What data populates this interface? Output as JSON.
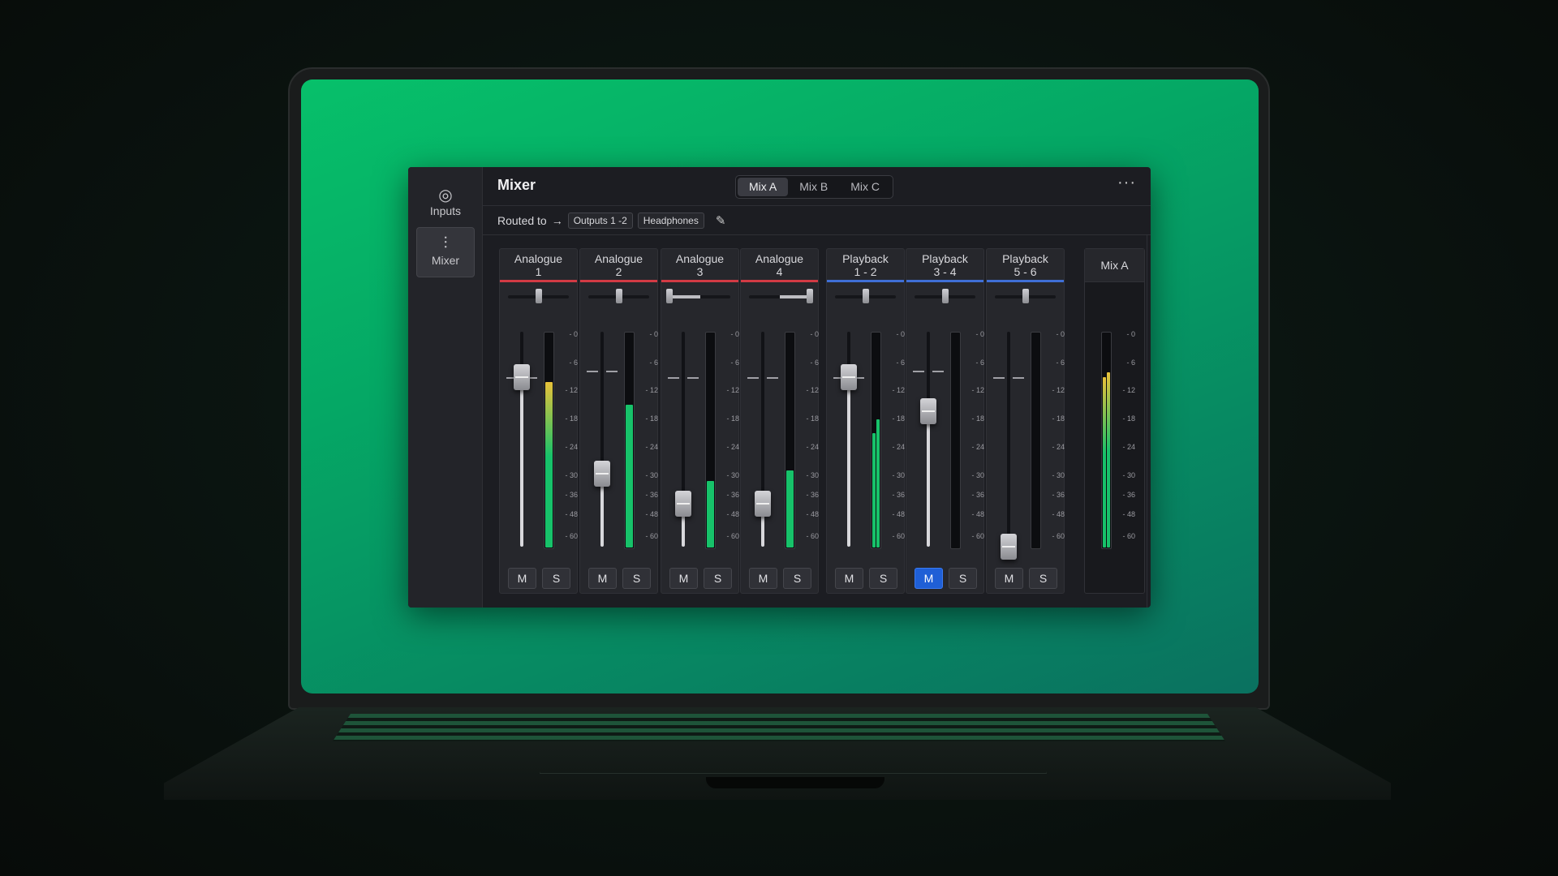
{
  "sidebar": {
    "items": [
      {
        "label": "Inputs",
        "icon": "inputs-icon",
        "active": false
      },
      {
        "label": "Mixer",
        "icon": "mixer-sliders-icon",
        "active": true
      }
    ]
  },
  "header": {
    "title": "Mixer",
    "tabs": [
      {
        "label": "Mix A",
        "active": true
      },
      {
        "label": "Mix B",
        "active": false
      },
      {
        "label": "Mix C",
        "active": false
      }
    ],
    "more_icon": "more-horizontal-icon"
  },
  "routing": {
    "label": "Routed to",
    "arrow": "→",
    "outputs": [
      "Outputs 1 -2",
      "Headphones"
    ],
    "edit_icon": "pencil-icon"
  },
  "colors": {
    "analogue": "#d23a44",
    "playback": "#3f6fd6",
    "meter_green": "#17c26a",
    "meter_yellow": "#e8c23a",
    "mute_active": "#1f5fd6"
  },
  "scale": [
    "0",
    "6",
    "12",
    "18",
    "24",
    "30",
    "36",
    "48",
    "60"
  ],
  "channels": [
    {
      "name": "Analogue\n1",
      "type": "analogue",
      "pan": 0.5,
      "fader": 0.79,
      "unity": 0.79,
      "meter_db": [
        -10
      ],
      "mute": false,
      "solo": false
    },
    {
      "name": "Analogue\n2",
      "type": "analogue",
      "pan": 0.5,
      "fader": 0.34,
      "unity": 0.82,
      "meter_db": [
        -15
      ],
      "mute": false,
      "solo": false
    },
    {
      "name": "Analogue\n3",
      "type": "analogue",
      "pan": 0.0,
      "fader": 0.2,
      "unity": 0.79,
      "meter_db": [
        -32
      ],
      "mute": false,
      "solo": false
    },
    {
      "name": "Analogue\n4",
      "type": "analogue",
      "pan": 1.0,
      "fader": 0.2,
      "unity": 0.79,
      "meter_db": [
        -29
      ],
      "mute": false,
      "solo": false
    },
    {
      "name": "Playback\n1 - 2",
      "type": "playback",
      "pan": 0.5,
      "fader": 0.79,
      "unity": 0.79,
      "meter_db": [
        -21,
        -18
      ],
      "mute": false,
      "solo": false
    },
    {
      "name": "Playback\n3 - 4",
      "type": "playback",
      "pan": 0.5,
      "fader": 0.63,
      "unity": 0.82,
      "meter_db": [
        null,
        null
      ],
      "mute": true,
      "solo": false
    },
    {
      "name": "Playback\n5 - 6",
      "type": "playback",
      "pan": 0.5,
      "fader": 0.0,
      "unity": 0.79,
      "meter_db": [
        null,
        null
      ],
      "mute": false,
      "solo": false
    }
  ],
  "buttons": {
    "mute": "M",
    "solo": "S"
  },
  "mix_master": {
    "name": "Mix A",
    "meter_db": [
      -9,
      -8
    ]
  }
}
